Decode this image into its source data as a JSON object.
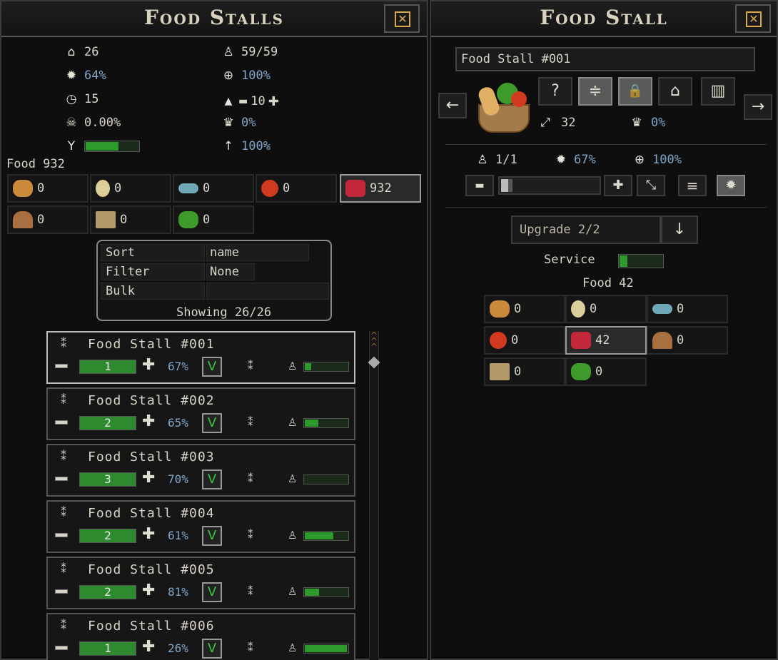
{
  "left_panel": {
    "title": "Food Stalls",
    "close_glyph": "☒",
    "stats_left": [
      {
        "icon": "house-icon",
        "glyph": "⌂",
        "value": "26"
      },
      {
        "icon": "gear-icon",
        "glyph": "✹",
        "value": "64%"
      },
      {
        "icon": "clock-icon",
        "glyph": "◷",
        "value": "15"
      },
      {
        "icon": "skull-icon",
        "glyph": "☠",
        "value": "0.00%"
      },
      {
        "icon": "person-arms-icon",
        "glyph": "Y",
        "bar": 0.6
      }
    ],
    "stats_right": [
      {
        "icon": "worker-icon",
        "glyph": "♙",
        "value": "59/59"
      },
      {
        "icon": "crosshair-icon",
        "glyph": "⊕",
        "value": "100%"
      },
      {
        "icon": "warning-icon",
        "glyph": "▲",
        "value": "10",
        "minus": "▬",
        "plus": "✚"
      },
      {
        "icon": "crown-icon",
        "glyph": "♛",
        "value": "0%"
      },
      {
        "icon": "arrow-up-icon",
        "glyph": "↑",
        "value": "100%"
      }
    ],
    "food_label": "Food 932",
    "resources": [
      {
        "name": "bread",
        "value": "0",
        "color": "#c98a3c"
      },
      {
        "name": "egg",
        "value": "0",
        "color": "#d8cf9c"
      },
      {
        "name": "fish",
        "value": "0",
        "color": "#6fa9b8"
      },
      {
        "name": "apple",
        "value": "0",
        "color": "#d23a1f"
      },
      {
        "name": "meat",
        "value": "932",
        "color": "#c2283a",
        "selected": true
      },
      {
        "name": "mushroom",
        "value": "0",
        "color": "#a8703e"
      },
      {
        "name": "crate",
        "value": "0",
        "color": "#b39a6a"
      },
      {
        "name": "vegetables",
        "value": "0",
        "color": "#3f9a2c"
      }
    ],
    "sort": {
      "sort_label": "Sort",
      "sort_value": "name",
      "filter_label": "Filter",
      "filter_value": "None",
      "bulk_label": "Bulk",
      "showing": "Showing 26/26"
    },
    "stalls": [
      {
        "name": "Food Stall #001",
        "level": "1",
        "pct": "67%",
        "check": "V",
        "bar": 0.15,
        "selected": true
      },
      {
        "name": "Food Stall #002",
        "level": "2",
        "pct": "65%",
        "check": "V",
        "bar": 0.3
      },
      {
        "name": "Food Stall #003",
        "level": "3",
        "pct": "70%",
        "check": "V",
        "bar": 0.0
      },
      {
        "name": "Food Stall #004",
        "level": "2",
        "pct": "61%",
        "check": "V",
        "bar": 0.65
      },
      {
        "name": "Food Stall #005",
        "level": "2",
        "pct": "81%",
        "check": "V",
        "bar": 0.33
      },
      {
        "name": "Food Stall #006",
        "level": "1",
        "pct": "26%",
        "check": "V",
        "bar": 0.95
      }
    ],
    "card_glyphs": {
      "move": "⁑",
      "minus": "▬",
      "plus": "✚",
      "worker": "♙"
    }
  },
  "right_panel": {
    "title": "Food Stall",
    "close_glyph": "☒",
    "name_value": "Food Stall #001",
    "nav_prev": "←",
    "nav_next": "→",
    "toolbar": [
      {
        "icon": "help-icon",
        "glyph": "?"
      },
      {
        "icon": "priority-icon",
        "glyph": "≑",
        "on": true
      },
      {
        "icon": "lock-icon",
        "glyph": "🔒",
        "on": true
      },
      {
        "icon": "house-outline-icon",
        "glyph": "⌂"
      },
      {
        "icon": "trash-icon",
        "glyph": "▥"
      }
    ],
    "size_glyph": "⤢",
    "size_value": "32",
    "crown_glyph": "♛",
    "crown_value": "0%",
    "workers_value": "1/1",
    "gear_value": "67%",
    "cross_value": "100%",
    "minus_glyph": "▬",
    "plus_glyph": "✚",
    "expand_glyph": "⤡",
    "list_glyph": "≡",
    "gear_glyph": "✹",
    "slider": 0.06,
    "upgrade_label": "Upgrade 2/2",
    "upgrade_arrow": "↓",
    "service_label": "Service",
    "service_bar": 0.18,
    "food_label": "Food 42",
    "resources": [
      {
        "name": "bread",
        "value": "0",
        "color": "#c98a3c"
      },
      {
        "name": "egg",
        "value": "0",
        "color": "#d8cf9c"
      },
      {
        "name": "fish",
        "value": "0",
        "color": "#6fa9b8"
      },
      {
        "name": "apple",
        "value": "0",
        "color": "#d23a1f"
      },
      {
        "name": "meat",
        "value": "42",
        "color": "#c2283a",
        "selected": true
      },
      {
        "name": "mushroom",
        "value": "0",
        "color": "#a8703e"
      },
      {
        "name": "crate",
        "value": "0",
        "color": "#b39a6a"
      },
      {
        "name": "vegetables",
        "value": "0",
        "color": "#3f9a2c"
      }
    ]
  }
}
